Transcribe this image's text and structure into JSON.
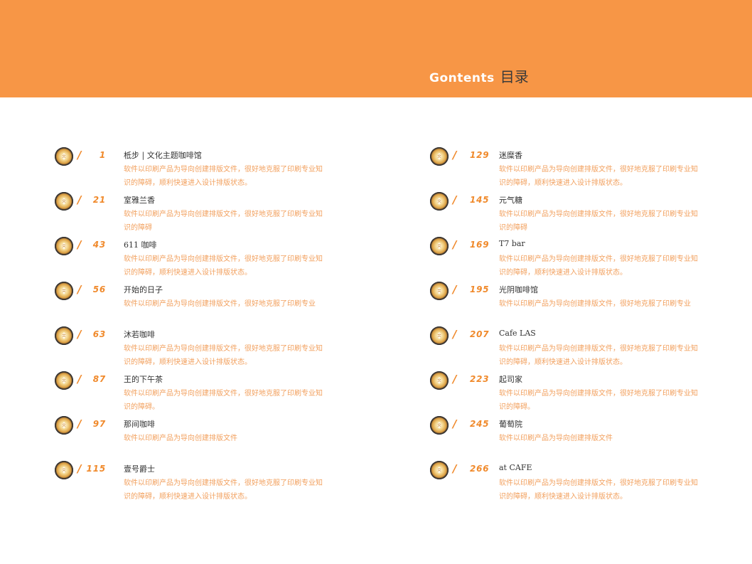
{
  "header": {
    "title_en": "Gontents",
    "title_zh": "目录",
    "bg_color": "#f79646"
  },
  "entries_left": [
    {
      "page": "1",
      "name": "柢步 | 文化主题咖啡馆",
      "desc": "软件以印刷产品为导向创建排版文件，很好地克服了印刷专业知识的障碍，顺利快速进入设计排版状态。"
    },
    {
      "page": "21",
      "name": "室雅兰香",
      "desc": "软件以印刷产品为导向创建排版文件，很好地克服了印刷专业知识的障碍"
    },
    {
      "page": "43",
      "name": "611 咖啡",
      "desc": "软件以印刷产品为导向创建排版文件，很好地克服了印刷专业知识的障碍，顺利快速进入设计排版状态。"
    },
    {
      "page": "56",
      "name": "开始的日子",
      "desc": "软件以印刷产品为导向创建排版文件，很好地克服了印刷专业"
    },
    {
      "page": "63",
      "name": "沐若咖啡",
      "desc": "软件以印刷产品为导向创建排版文件，很好地克服了印刷专业知识的障碍，顺利快速进入设计排版状态。"
    },
    {
      "page": "87",
      "name": "王的下午茶",
      "desc": "软件以印刷产品为导向创建排版文件，很好地克服了印刷专业知识的障碍。"
    },
    {
      "page": "97",
      "name": "那间咖啡",
      "desc": "软件以印刷产品为导向创建排版文件"
    },
    {
      "page": "115",
      "name": "壹号爵士",
      "desc": "软件以印刷产品为导向创建排版文件，很好地克服了印刷专业知识的障碍，顺利快速进入设计排版状态。"
    }
  ],
  "entries_right": [
    {
      "page": "129",
      "name": "迷糜香",
      "desc": "软件以印刷产品为导向创建排版文件，很好地克服了印刷专业知识的障碍，顺利快速进入设计排版状态。"
    },
    {
      "page": "145",
      "name": "元气糖",
      "desc": "软件以印刷产品为导向创建排版文件，很好地克服了印刷专业知识的障碍"
    },
    {
      "page": "169",
      "name": "T7 bar",
      "desc": "软件以印刷产品为导向创建排版文件，很好地克服了印刷专业知识的障碍，顺利快速进入设计排版状态。"
    },
    {
      "page": "195",
      "name": "光阴咖啡馆",
      "desc": "软件以印刷产品为导向创建排版文件，很好地克服了印刷专业"
    },
    {
      "page": "207",
      "name": "Cafe LAS",
      "desc": "软件以印刷产品为导向创建排版文件，很好地克服了印刷专业知识的障碍，顺利快速进入设计排版状态。"
    },
    {
      "page": "223",
      "name": "起司家",
      "desc": "软件以印刷产品为导向创建排版文件，很好地克服了印刷专业知识的障碍。"
    },
    {
      "page": "245",
      "name": "葡萄院",
      "desc": "软件以印刷产品为导向创建排版文件"
    },
    {
      "page": "266",
      "name": "at CAFE",
      "desc": "软件以印刷产品为导向创建排版文件，很好地克服了印刷专业知识的障碍，顺利快速进入设计排版状态。"
    }
  ],
  "icon": "coffee-cup-latte-art-icon",
  "accent_color": "#f08a2c",
  "desc_color": "#f2a05e"
}
